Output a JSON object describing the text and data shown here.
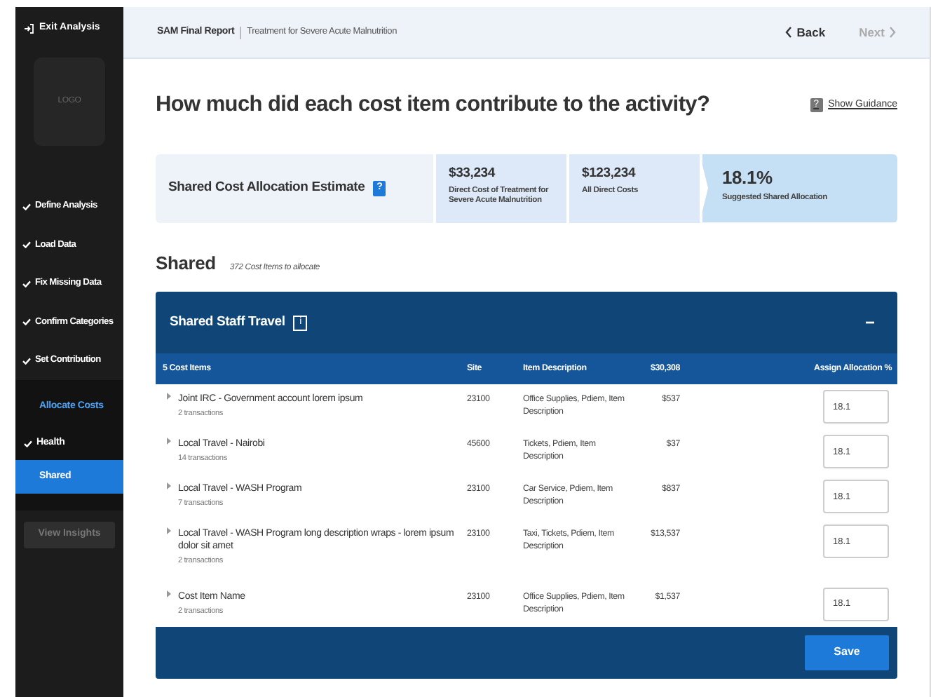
{
  "sidebar": {
    "exit_label": "Exit Analysis",
    "logo": "LOGO",
    "steps": [
      {
        "label": "Define Analysis",
        "done": true
      },
      {
        "label": "Load Data",
        "done": true
      },
      {
        "label": "Fix Missing Data",
        "done": true
      },
      {
        "label": "Confirm Categories",
        "done": true
      },
      {
        "label": "Set Contribution",
        "done": true
      }
    ],
    "substep_title": "Allocate Costs",
    "substeps": [
      {
        "label": "Health",
        "done": true,
        "selected": false
      },
      {
        "label": "Shared",
        "done": false,
        "selected": true
      }
    ],
    "insights_button": {
      "label": "View Insights",
      "disabled": true
    }
  },
  "header": {
    "report": "SAM Final Report",
    "subtitle": "Treatment for Severe Acute Malnutrition",
    "back": "Back",
    "next": {
      "label": "Next",
      "disabled": true
    }
  },
  "title": "How much did each cost item contribute to the activity?",
  "guidance": {
    "icon": "?",
    "label": "Show Guidance"
  },
  "estimate": {
    "label": "Shared Cost Allocation Estimate",
    "help_icon": "?",
    "metrics": [
      {
        "value": "$33,234",
        "caption": "Direct Cost of Treatment for Severe Acute Malnutrition",
        "kind": "plain"
      },
      {
        "value": "$123,234",
        "caption": "All Direct Costs",
        "kind": "plain"
      },
      {
        "value": "18.1%",
        "caption": "Suggested Shared Allocation",
        "kind": "result"
      }
    ]
  },
  "section": {
    "title": "Shared",
    "count": "372 Cost Items to allocate"
  },
  "panel": {
    "title": "Shared Staff Travel",
    "info_icon": "i",
    "collapse": "−",
    "expanded": true,
    "columns": [
      "5 Cost Items",
      "Site",
      "Item Description",
      "$30,308",
      "Assign Allocation %"
    ],
    "rows": [
      {
        "name": "Joint IRC - Government account lorem ipsum",
        "transactions": "2 transactions",
        "site": "23100",
        "description": "Office Supplies, Pdiem, Item Description",
        "amount": "$537",
        "allocation": "18.1"
      },
      {
        "name": "Local Travel - Nairobi",
        "transactions": "14 transactions",
        "site": "45600",
        "description": "Tickets, Pdiem, Item Description",
        "amount": "$37",
        "allocation": "18.1"
      },
      {
        "name": "Local Travel - WASH Program",
        "transactions": "7 transactions",
        "site": "23100",
        "description": "Car Service, Pdiem, Item Description",
        "amount": "$837",
        "allocation": "18.1"
      },
      {
        "name": "Local Travel - WASH Program long description wraps - lorem ipsum dolor sit amet",
        "transactions": "2 transactions",
        "site": "23100",
        "description": "Taxi, Tickets, Pdiem, Item Description",
        "amount": "$13,537",
        "allocation": "18.1"
      },
      {
        "name": "Cost Item Name",
        "transactions": "2 transactions",
        "site": "23100",
        "description": "Office Supplies, Pdiem, Item Description",
        "amount": "$1,537",
        "allocation": "18.1"
      }
    ],
    "save": "Save"
  }
}
